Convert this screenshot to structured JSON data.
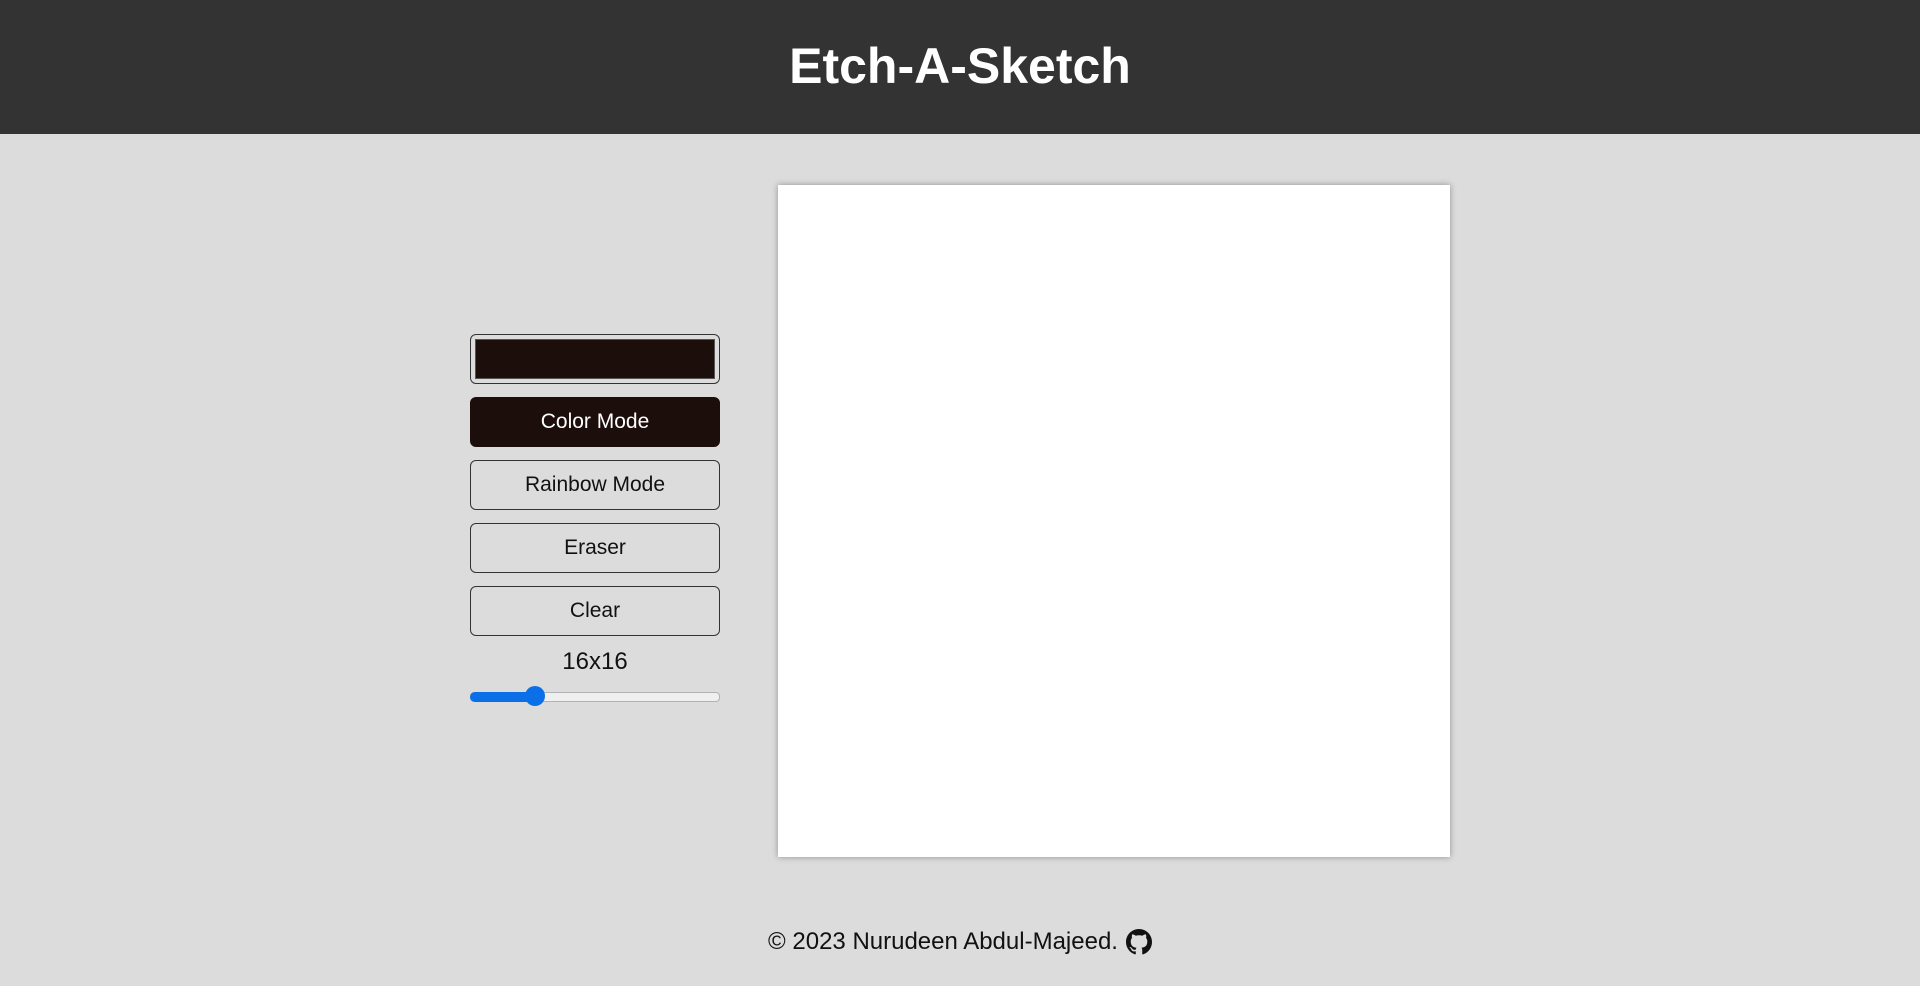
{
  "header": {
    "title": "Etch-A-Sketch"
  },
  "controls": {
    "color_value": "#1c0e0b",
    "color_mode_label": "Color Mode",
    "rainbow_mode_label": "Rainbow Mode",
    "eraser_label": "Eraser",
    "clear_label": "Clear",
    "grid_size_label": "16x16",
    "grid_size_value": 16,
    "grid_size_min": 1,
    "grid_size_max": 64,
    "active_mode": "color"
  },
  "footer": {
    "copyright": "© 2023 Nurudeen Abdul-Majeed.",
    "github_icon": "github-icon"
  },
  "colors": {
    "header_bg": "#333333",
    "page_bg": "#dcdcdc",
    "active_button": "#1c0e0b",
    "slider_accent": "#0b6fe8"
  }
}
